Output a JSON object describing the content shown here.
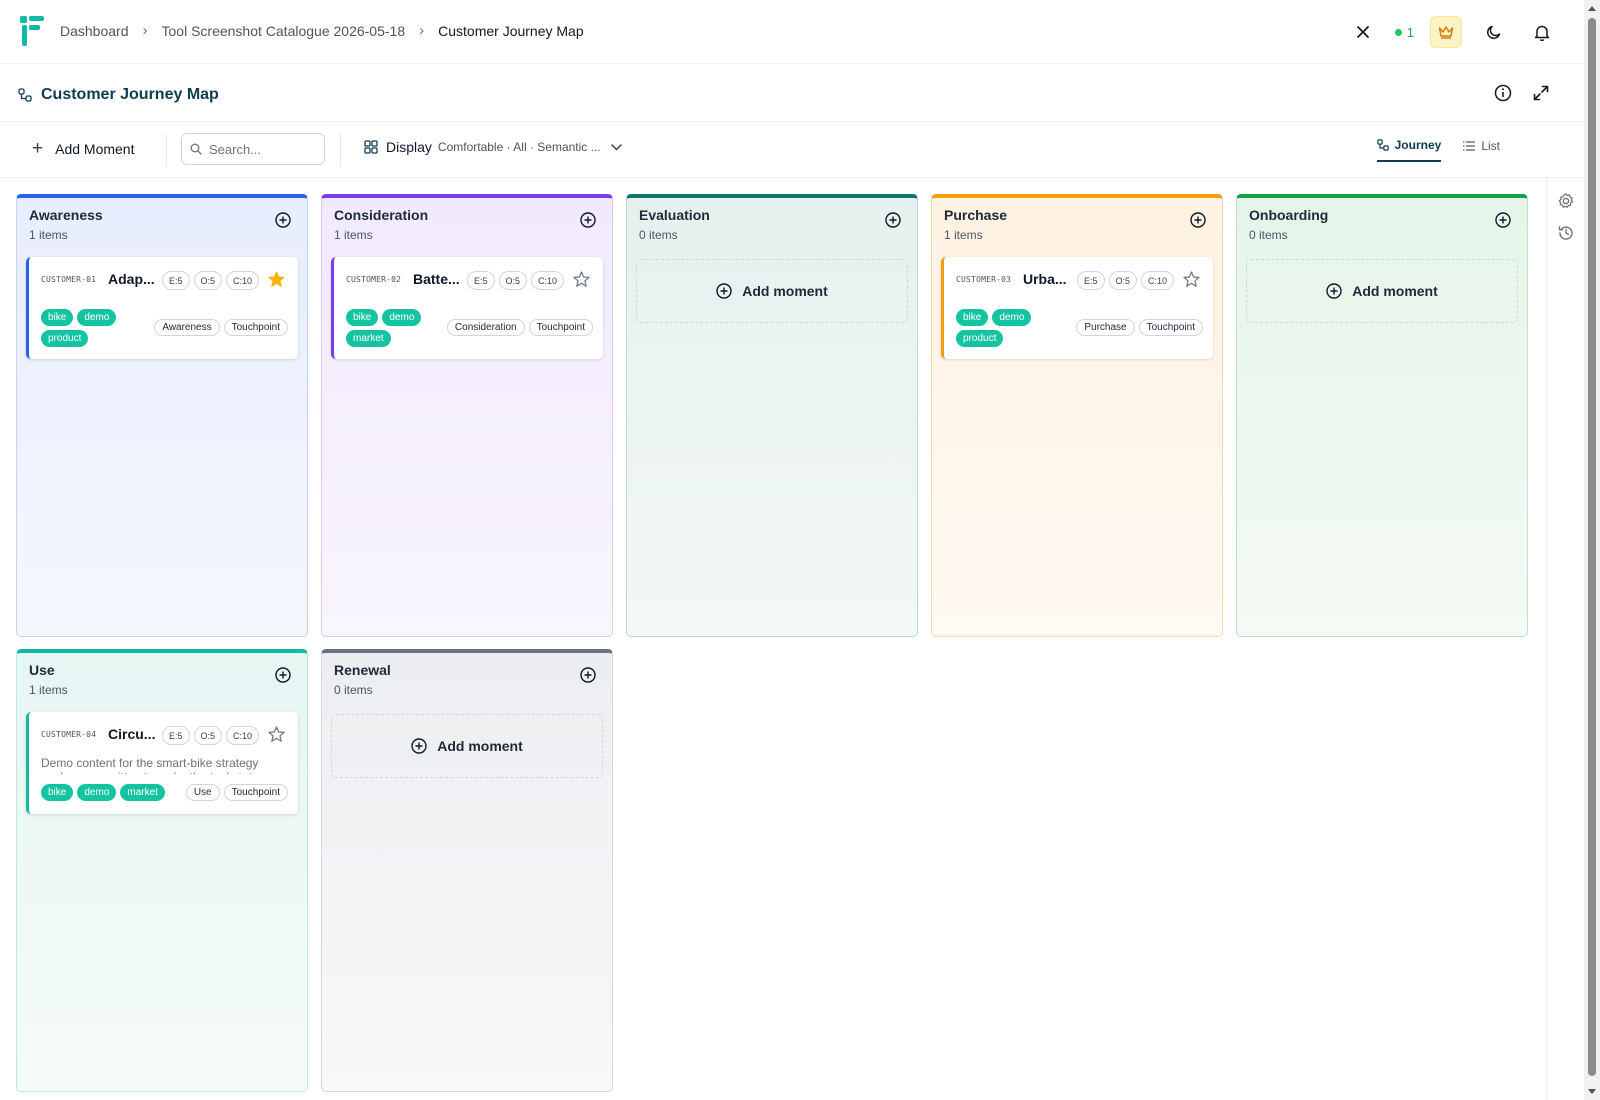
{
  "breadcrumb": [
    {
      "label": "Dashboard"
    },
    {
      "label": "Tool Screenshot Catalogue 2026-05-18"
    },
    {
      "label": "Customer Journey Map"
    }
  ],
  "topbar": {
    "online_count": "1",
    "icons": [
      "close-icon",
      "crown-icon",
      "moon-icon",
      "bell-icon"
    ]
  },
  "page": {
    "title": "Customer Journey Map",
    "icons": [
      "info-icon",
      "expand-icon"
    ]
  },
  "toolbar": {
    "add_label": "Add Moment",
    "search_placeholder": "Search...",
    "display_label": "Display",
    "display_value": "Comfortable · All · Semantic ...",
    "views": [
      {
        "label": "Journey",
        "active": true
      },
      {
        "label": "List",
        "active": false
      }
    ]
  },
  "colors": {
    "awareness": "#2563eb",
    "consideration": "#7c3aed",
    "evaluation": "#0f766e",
    "purchase": "#f59e0b",
    "onboarding": "#16a34a",
    "use": "#14b8a6",
    "renewal": "#6b7280",
    "tag": "#14c4a1",
    "brand": "#14b8a6"
  },
  "stages": [
    {
      "name": "Awareness",
      "count": "1 items",
      "add_text": "Add moment",
      "card": {
        "id": "CUSTOMER-01",
        "title": "Adap...",
        "scores": [
          "E:5",
          "O:5",
          "C:10"
        ],
        "starred": true,
        "tags": [
          "bike",
          "demo",
          "product"
        ],
        "chips": [
          "Awareness",
          "Touchpoint"
        ],
        "description": ""
      }
    },
    {
      "name": "Consideration",
      "count": "1 items",
      "add_text": "Add moment",
      "card": {
        "id": "CUSTOMER-02",
        "title": "Batte...",
        "scores": [
          "E:5",
          "O:5",
          "C:10"
        ],
        "starred": false,
        "tags": [
          "bike",
          "demo",
          "market"
        ],
        "chips": [
          "Consideration",
          "Touchpoint"
        ],
        "description": ""
      }
    },
    {
      "name": "Evaluation",
      "count": "0 items",
      "add_text": "Add moment",
      "card": null
    },
    {
      "name": "Purchase",
      "count": "1 items",
      "add_text": "Add moment",
      "card": {
        "id": "CUSTOMER-03",
        "title": "Urba...",
        "scores": [
          "E:5",
          "O:5",
          "C:10"
        ],
        "starred": false,
        "tags": [
          "bike",
          "demo",
          "product"
        ],
        "chips": [
          "Purchase",
          "Touchpoint"
        ],
        "description": ""
      }
    },
    {
      "name": "Onboarding",
      "count": "0 items",
      "add_text": "Add moment",
      "card": null
    },
    {
      "name": "Use",
      "count": "1 items",
      "add_text": "Add moment",
      "card": {
        "id": "CUSTOMER-04",
        "title": "Circu...",
        "scores": [
          "E:5",
          "O:5",
          "C:10"
        ],
        "starred": false,
        "tags": [
          "bike",
          "demo",
          "market"
        ],
        "chips": [
          "Use",
          "Touchpoint"
        ],
        "description": "Demo content for the smart-bike strategy workspace, written to make the tool state"
      }
    },
    {
      "name": "Renewal",
      "count": "0 items",
      "add_text": "Add moment",
      "card": null
    }
  ]
}
